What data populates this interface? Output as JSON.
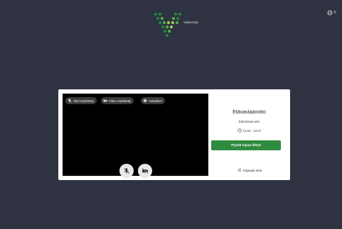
{
  "header": {
    "logo_text": "VideoVisit",
    "language": "fi"
  },
  "video": {
    "audio_toggle_label": "Ääni mykistetty",
    "video_toggle_label": "Video mykistetty",
    "settings_label": "Asetukset"
  },
  "room": {
    "title": "Etävastaanotto",
    "subtitle": "Etävastaanotto",
    "time": "11.52 - 12.07",
    "join_label": "Pyydä lupaa liittyä",
    "logout_label": "Kirjaudu ulos"
  },
  "colors": {
    "background": "#2f3341",
    "join_button": "#2e8b3e",
    "logo_green_light": "#9ed24a",
    "logo_green_dark": "#1f8a3c"
  },
  "icons": {
    "mic_off": "mic-off-icon",
    "video_off": "video-off-icon",
    "settings": "gear-icon",
    "clock": "clock-icon",
    "logout": "logout-icon",
    "language": "globe-icon"
  }
}
